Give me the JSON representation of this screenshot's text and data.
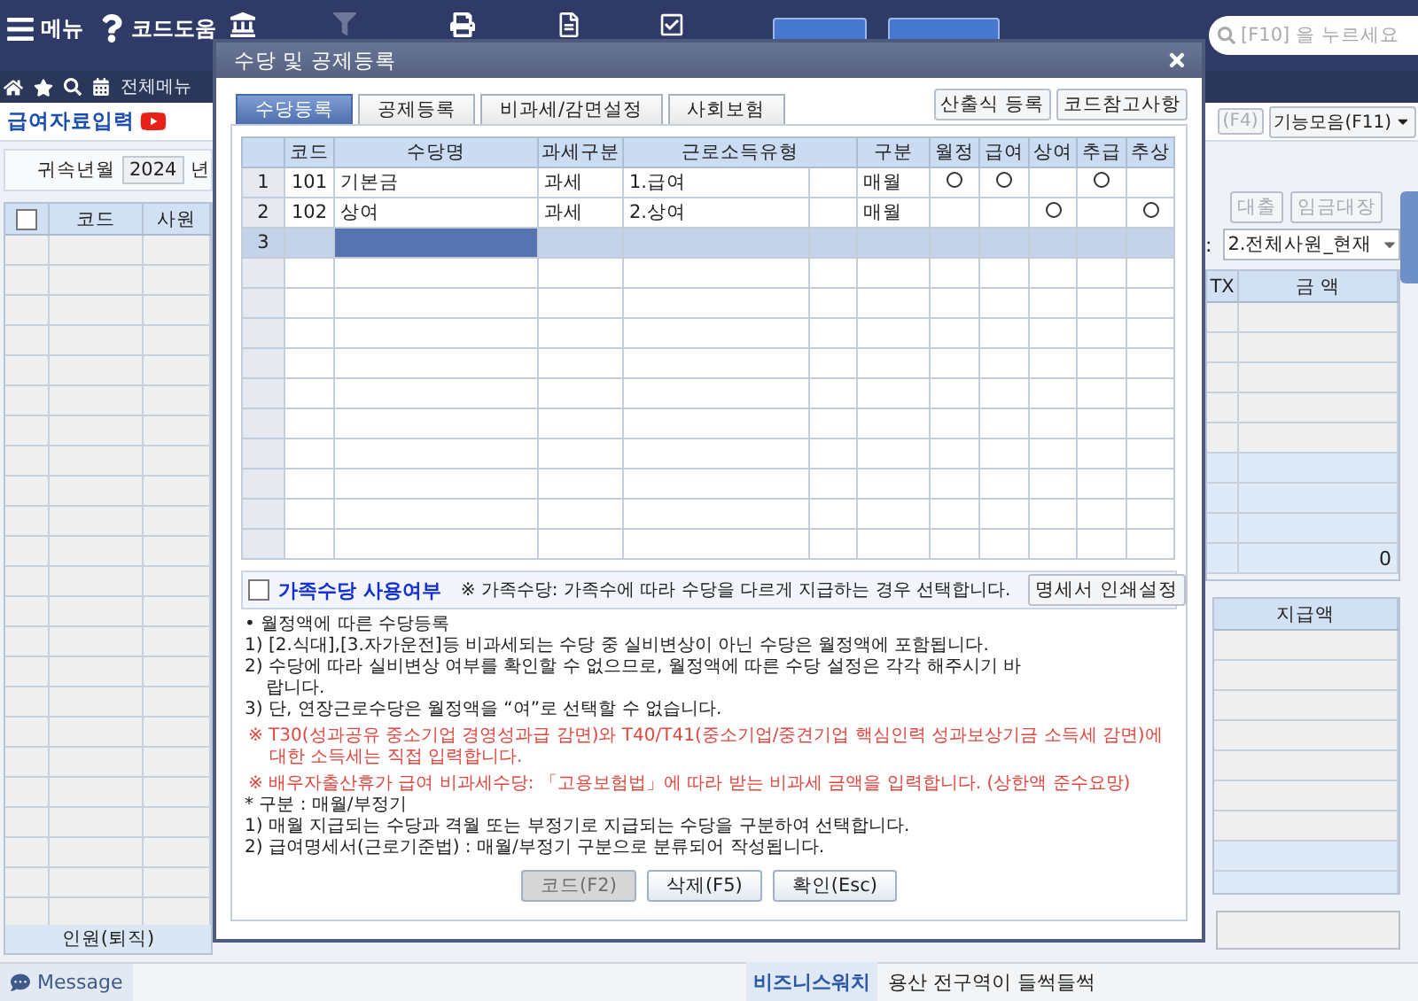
{
  "toolbar": {
    "items": [
      {
        "label": "메뉴"
      },
      {
        "label": "코드도움"
      }
    ],
    "search": {
      "placeholder": "[F10] 을 누르세요"
    }
  },
  "nav": {
    "label": "전체메뉴"
  },
  "page": {
    "title": "급여자료입력",
    "buttons": [
      {
        "label": "(F4)",
        "disabled": true
      },
      {
        "label": "기능모음(F11)",
        "disabled": false
      }
    ]
  },
  "filter": {
    "label": "귀속년월",
    "year": "2024",
    "unit": "년"
  },
  "employee_table": {
    "columns": [
      "코드",
      "사원"
    ],
    "all_checked": false,
    "footer": "인원(퇴직)"
  },
  "side_panel": {
    "buttons": [
      "대출",
      "임금대장"
    ],
    "separator": ":",
    "view": "2.전체사원_현재",
    "amount_table": {
      "columns": [
        "TX",
        "금 액"
      ],
      "total": "0"
    },
    "pay_table": {
      "columns": [
        "지급액"
      ]
    }
  },
  "dialog": {
    "title": "수당 및 공제등록",
    "tabs": [
      {
        "label": "수당등록",
        "selected": true
      },
      {
        "label": "공제등록",
        "selected": false
      },
      {
        "label": "비과세/감면설정",
        "selected": false
      },
      {
        "label": "사회보험",
        "selected": false
      }
    ],
    "actions": [
      "산출식 등록",
      "코드참고사항"
    ],
    "grid": {
      "columns": [
        "코드",
        "수당명",
        "과세구분",
        "근로소득유형",
        "구분",
        "월정",
        "급여",
        "상여",
        "추급",
        "추상"
      ],
      "rows": [
        {
          "number": "1",
          "code": "101",
          "name": "기본금",
          "tax": "과세",
          "income_type": "1.급여",
          "cycle": "매월",
          "flags": [
            true,
            true,
            false,
            true,
            false
          ],
          "selected": false
        },
        {
          "number": "2",
          "code": "102",
          "name": "상여",
          "tax": "과세",
          "income_type": "2.상여",
          "cycle": "매월",
          "flags": [
            false,
            false,
            true,
            false,
            true
          ],
          "selected": false
        },
        {
          "number": "3",
          "selected": true
        }
      ]
    },
    "family": {
      "checked": false,
      "label": "가족수당 사용여부",
      "note": "※ 가족수당: 가족수에 따라 수당을 다르게 지급하는 경우 선택합니다.",
      "button": "명세서 인쇄설정"
    },
    "notes": [
      {
        "kind": "heading",
        "text": "• 월정액에 따른 수당등록"
      },
      {
        "kind": "item",
        "text": "1) [2.식대],[3.자가운전]등 비과세되는 수당 중 실비변상이 아닌 수당은 월정액에 포함됩니다."
      },
      {
        "kind": "item",
        "text": "2) 수당에 따라 실비변상 여부를 확인할 수 없으므로, 월정액에 따른 수당 설정은 각각 해주시기 바랍니다."
      },
      {
        "kind": "item",
        "text": "3) 단, 연장근로수당은 월정액을 “여”로 선택할 수 없습니다."
      },
      {
        "kind": "warning",
        "text": "※ T30(성과공유 중소기업 경영성과급 감면)와 T40/T41(중소기업/중견기업 핵심인력 성과보상기금 소득세 감면)에 대한 소득세는 직접 입력합니다."
      },
      {
        "kind": "warning",
        "text": "※ 배우자출산휴가 급여 비과세수당: 「고용보험법」에 따라 받는 비과세 금액을 입력합니다. (상한액 준수요망)"
      },
      {
        "kind": "heading",
        "text": "* 구분 : 매월/부정기"
      },
      {
        "kind": "item",
        "text": "1) 매월 지급되는 수당과 격월 또는 부정기로 지급되는 수당을 구분하여 선택합니다."
      },
      {
        "kind": "item",
        "text": "2) 급여명세서(근로기준법) : 매월/부정기 구분으로 분류되어 작성됩니다."
      }
    ],
    "buttons": [
      {
        "label": "코드(F2)",
        "disabled": true
      },
      {
        "label": "삭제(F5)",
        "disabled": false
      },
      {
        "label": "확인(Esc)",
        "disabled": false
      }
    ]
  },
  "status_bar": {
    "message_tab": "Message",
    "news_source": "비즈니스워치",
    "headline": "용산 전구역이 들썩들썩"
  }
}
